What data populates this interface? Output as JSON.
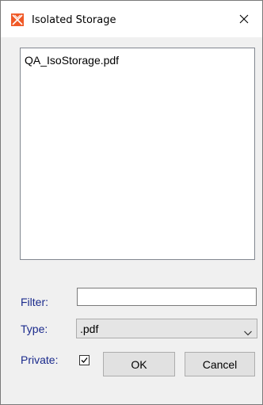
{
  "window": {
    "title": "Isolated Storage",
    "icon": "orange-x-app-icon",
    "close_icon": "close-icon"
  },
  "file_list": {
    "items": [
      "QA_IsoStorage.pdf"
    ]
  },
  "filter": {
    "label": "Filter:",
    "value": ""
  },
  "type": {
    "label": "Type:",
    "selected": ".pdf"
  },
  "private": {
    "label": "Private:",
    "checked": true
  },
  "buttons": {
    "ok_label": "OK",
    "cancel_label": "Cancel"
  },
  "colors": {
    "label_text": "#1a2a8c",
    "app_icon": "#f05a28",
    "dialog_background": "#f0f0f0"
  }
}
